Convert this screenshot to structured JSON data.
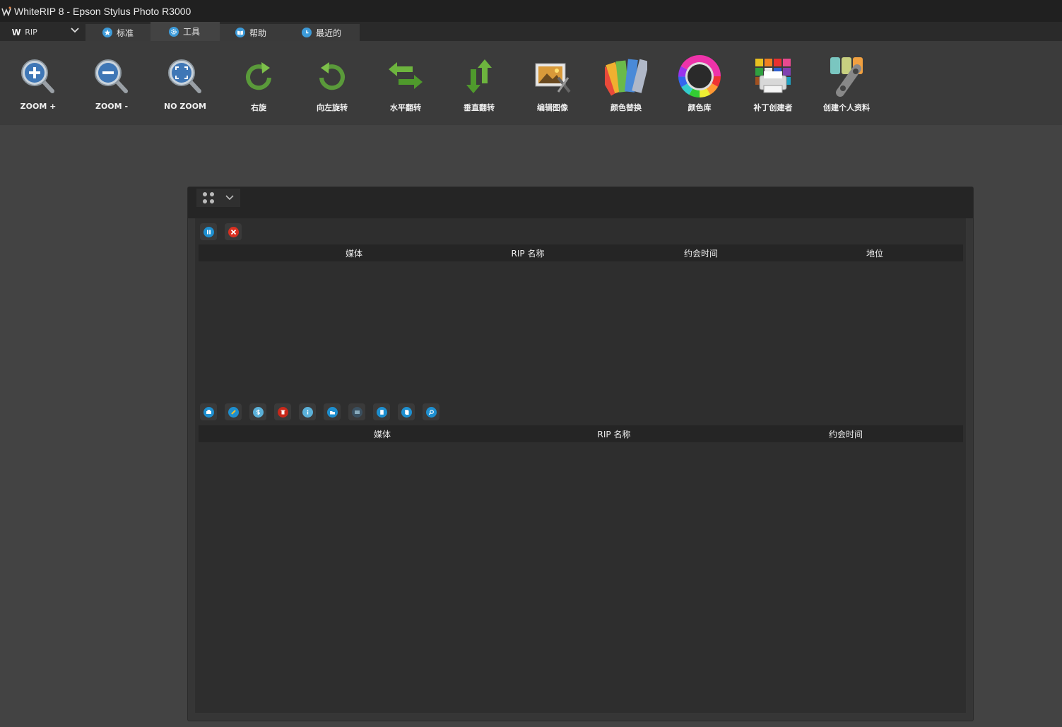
{
  "window": {
    "title": "WhiteRIP 8 - Epson Stylus Photo R3000",
    "logo_icon": "whiterip-logo-icon"
  },
  "menu": {
    "rip_label": "RIP",
    "tabs": [
      {
        "label": "标准",
        "icon": "star-icon"
      },
      {
        "label": "工具",
        "icon": "gear-icon"
      },
      {
        "label": "帮助",
        "icon": "book-icon"
      },
      {
        "label": "最近的",
        "icon": "clock-icon"
      }
    ]
  },
  "toolbar": {
    "items": [
      {
        "label": "ZOOM +",
        "icon": "zoom-in-icon"
      },
      {
        "label": "ZOOM -",
        "icon": "zoom-out-icon"
      },
      {
        "label": "NO ZOOM",
        "icon": "zoom-reset-icon"
      },
      {
        "label": "右旋",
        "icon": "rotate-right-icon"
      },
      {
        "label": "向左旋转",
        "icon": "rotate-left-icon"
      },
      {
        "label": "水平翻转",
        "icon": "flip-horizontal-icon"
      },
      {
        "label": "垂直翻转",
        "icon": "flip-vertical-icon"
      },
      {
        "label": "编辑图像",
        "icon": "edit-image-icon"
      },
      {
        "label": "颜色替换",
        "icon": "color-swatch-icon"
      },
      {
        "label": "颜色库",
        "icon": "color-wheel-icon"
      },
      {
        "label": "补丁创建者",
        "icon": "patch-creator-icon"
      },
      {
        "label": "创建个人资料",
        "icon": "create-profile-icon"
      }
    ]
  },
  "queue_top": {
    "buttons": [
      {
        "icon": "pause-icon",
        "color": "#1e8fcf"
      },
      {
        "icon": "cancel-icon",
        "color": "#d93020"
      }
    ],
    "columns": [
      "媒体",
      "RIP 名称",
      "约会时间",
      "地位"
    ]
  },
  "queue_bottom": {
    "buttons": [
      {
        "icon": "print-icon",
        "color": "#1e8fcf"
      },
      {
        "icon": "edit-icon",
        "color": "#1e8fcf"
      },
      {
        "icon": "dollar-icon",
        "color": "#5ab0d8"
      },
      {
        "icon": "delete-icon",
        "color": "#c8281a"
      },
      {
        "icon": "info-icon",
        "color": "#5ab0d8"
      },
      {
        "icon": "open-folder-icon",
        "color": "#1e8fcf"
      },
      {
        "icon": "image-icon",
        "color": "#3a5060"
      },
      {
        "icon": "document-icon",
        "color": "#1e8fcf"
      },
      {
        "icon": "copy-icon",
        "color": "#1e8fcf"
      },
      {
        "icon": "preview-icon",
        "color": "#1e8fcf"
      }
    ],
    "columns": [
      "媒体",
      "RIP 名称",
      "约会时间"
    ]
  }
}
